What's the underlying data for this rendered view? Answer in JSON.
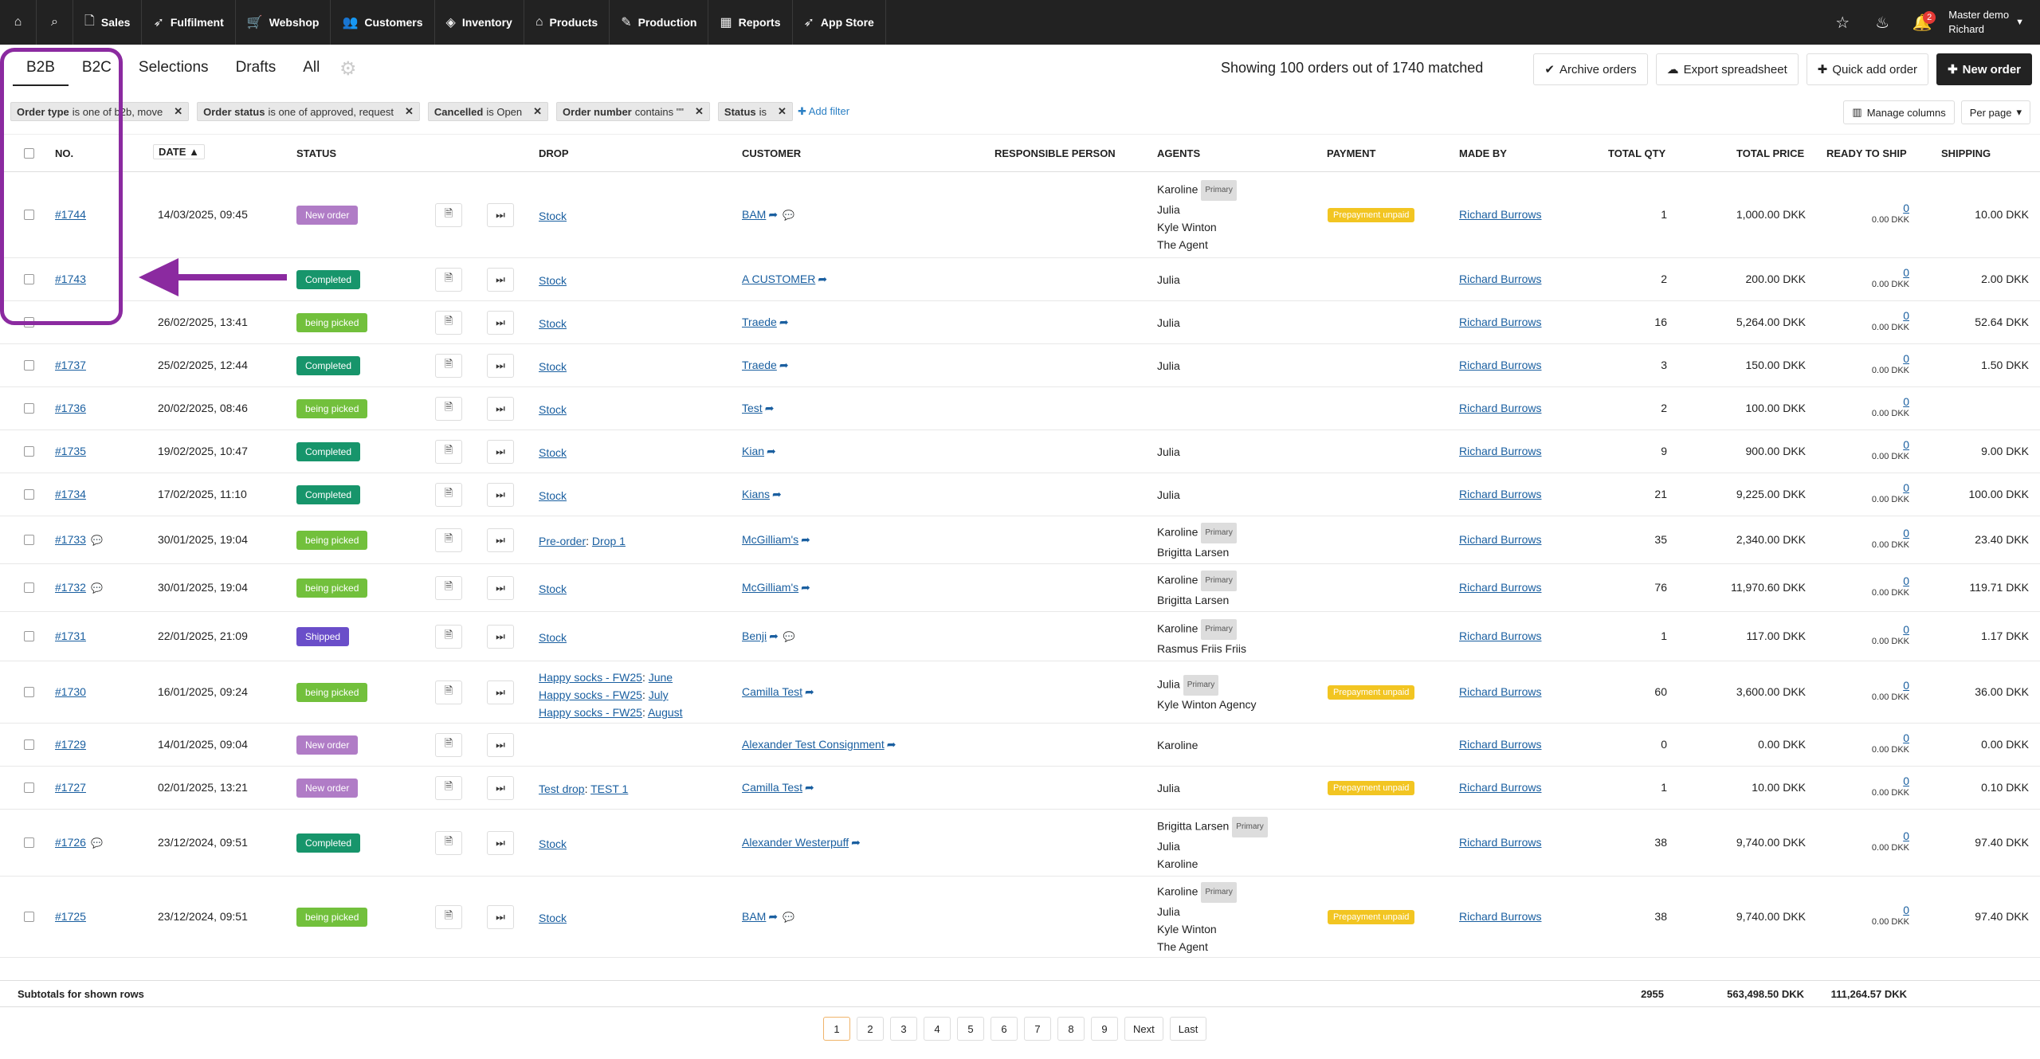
{
  "nav": {
    "items": [
      {
        "label": "Sales",
        "icon": "document-icon"
      },
      {
        "label": "Fulfilment",
        "icon": "rocket-icon"
      },
      {
        "label": "Webshop",
        "icon": "cart-icon"
      },
      {
        "label": "Customers",
        "icon": "users-icon"
      },
      {
        "label": "Inventory",
        "icon": "layers-icon"
      },
      {
        "label": "Products",
        "icon": "tag-icon"
      },
      {
        "label": "Production",
        "icon": "pencil-icon"
      },
      {
        "label": "Reports",
        "icon": "chart-icon"
      },
      {
        "label": "App Store",
        "icon": "rocket-icon"
      }
    ],
    "notifications": "2",
    "user_line1": "Master demo",
    "user_line2": "Richard"
  },
  "tabs": [
    "B2B",
    "B2C",
    "Selections",
    "Drafts",
    "All"
  ],
  "showing": "Showing 100 orders out of 1740 matched",
  "actions": {
    "archive": "Archive orders",
    "export": "Export spreadsheet",
    "quick_add": "Quick add order",
    "new_order": "New order"
  },
  "filters": [
    {
      "field": "Order type",
      "rest": "is one of b2b, move"
    },
    {
      "field": "Order status",
      "rest": "is one of approved, request"
    },
    {
      "field": "Cancelled",
      "rest": "is Open"
    },
    {
      "field": "Order number",
      "rest": "contains \"\""
    },
    {
      "field": "Status",
      "rest": "is"
    }
  ],
  "add_filter": "Add filter",
  "manage_columns": "Manage columns",
  "per_page": "Per page",
  "columns": {
    "no": "NO.",
    "date": "DATE",
    "status": "STATUS",
    "drop": "DROP",
    "customer": "CUSTOMER",
    "responsible": "RESPONSIBLE PERSON",
    "agents": "AGENTS",
    "payment": "PAYMENT",
    "made_by": "MADE BY",
    "total_qty": "TOTAL QTY",
    "total_price": "TOTAL PRICE",
    "ready": "READY TO SHIP",
    "shipping": "SHIPPING"
  },
  "rows": [
    {
      "no": "#1744",
      "date": "14/03/2025, 09:45",
      "status": "New order",
      "drop": "Stock",
      "customer": "BAM",
      "agents": "Karoline|Julia|Kyle Winton|The Agent",
      "payment": "Prepayment unpaid",
      "made_by": "Richard Burrows",
      "qty": "1",
      "price": "1,000.00 DKK",
      "ready": "0",
      "ready_sub": "0.00 DKK",
      "shipping": "10.00 DKK"
    },
    {
      "no": "#1743",
      "date": "",
      "status": "Completed",
      "drop": "Stock",
      "customer": "A CUSTOMER",
      "agents": "Julia",
      "payment": "",
      "made_by": "Richard Burrows",
      "qty": "2",
      "price": "200.00 DKK",
      "ready": "0",
      "ready_sub": "0.00 DKK",
      "shipping": "2.00 DKK"
    },
    {
      "no": "",
      "date": "26/02/2025, 13:41",
      "status": "being picked",
      "drop": "Stock",
      "customer": "Traede",
      "agents": "Julia",
      "payment": "",
      "made_by": "Richard Burrows",
      "qty": "16",
      "price": "5,264.00 DKK",
      "ready": "0",
      "ready_sub": "0.00 DKK",
      "shipping": "52.64 DKK"
    },
    {
      "no": "#1737",
      "date": "25/02/2025, 12:44",
      "status": "Completed",
      "drop": "Stock",
      "customer": "Traede",
      "agents": "Julia",
      "payment": "",
      "made_by": "Richard Burrows",
      "qty": "3",
      "price": "150.00 DKK",
      "ready": "0",
      "ready_sub": "0.00 DKK",
      "shipping": "1.50 DKK"
    },
    {
      "no": "#1736",
      "date": "20/02/2025, 08:46",
      "status": "being picked",
      "drop": "Stock",
      "customer": "Test",
      "agents": "",
      "payment": "",
      "made_by": "Richard Burrows",
      "qty": "2",
      "price": "100.00 DKK",
      "ready": "0",
      "ready_sub": "0.00 DKK",
      "shipping": ""
    },
    {
      "no": "#1735",
      "date": "19/02/2025, 10:47",
      "status": "Completed",
      "drop": "Stock",
      "customer": "Kian",
      "agents": "Julia",
      "payment": "",
      "made_by": "Richard Burrows",
      "qty": "9",
      "price": "900.00 DKK",
      "ready": "0",
      "ready_sub": "0.00 DKK",
      "shipping": "9.00 DKK"
    },
    {
      "no": "#1734",
      "date": "17/02/2025, 11:10",
      "status": "Completed",
      "drop": "Stock",
      "customer": "Kians",
      "agents": "Julia",
      "payment": "",
      "made_by": "Richard Burrows",
      "qty": "21",
      "price": "9,225.00 DKK",
      "ready": "0",
      "ready_sub": "0.00 DKK",
      "shipping": "100.00 DKK"
    },
    {
      "no": "#1733",
      "date": "30/01/2025, 19:04",
      "status": "being picked",
      "drop": "Pre-order|Drop 1",
      "customer": "McGilliam's",
      "agents": "Karoline|Brigitta Larsen",
      "payment": "",
      "made_by": "Richard Burrows",
      "qty": "35",
      "price": "2,340.00 DKK",
      "ready": "0",
      "ready_sub": "0.00 DKK",
      "shipping": "23.40 DKK"
    },
    {
      "no": "#1732",
      "date": "30/01/2025, 19:04",
      "status": "being picked",
      "drop": "Stock",
      "customer": "McGilliam's",
      "agents": "Karoline|Brigitta Larsen",
      "payment": "",
      "made_by": "Richard Burrows",
      "qty": "76",
      "price": "11,970.60 DKK",
      "ready": "0",
      "ready_sub": "0.00 DKK",
      "shipping": "119.71 DKK"
    },
    {
      "no": "#1731",
      "date": "22/01/2025, 21:09",
      "status": "Shipped",
      "drop": "Stock",
      "customer": "Benji",
      "agents": "Karoline|Rasmus Friis Friis",
      "payment": "",
      "made_by": "Richard Burrows",
      "qty": "1",
      "price": "117.00 DKK",
      "ready": "0",
      "ready_sub": "0.00 DKK",
      "shipping": "1.17 DKK"
    },
    {
      "no": "#1730",
      "date": "16/01/2025, 09:24",
      "status": "being picked",
      "drop": "Happy socks - FW25|June|Happy socks - FW25|July|Happy socks - FW25|August",
      "customer": "Camilla Test",
      "agents": "Julia|Kyle Winton Agency",
      "payment": "Prepayment unpaid",
      "made_by": "Richard Burrows",
      "qty": "60",
      "price": "3,600.00 DKK",
      "ready": "0",
      "ready_sub": "0.00 DKK",
      "shipping": "36.00 DKK"
    },
    {
      "no": "#1729",
      "date": "14/01/2025, 09:04",
      "status": "New order",
      "drop": "",
      "customer": "Alexander Test Consignment",
      "agents": "Karoline",
      "payment": "",
      "made_by": "Richard Burrows",
      "qty": "0",
      "price": "0.00 DKK",
      "ready": "0",
      "ready_sub": "0.00 DKK",
      "shipping": "0.00 DKK"
    },
    {
      "no": "#1727",
      "date": "02/01/2025, 13:21",
      "status": "New order",
      "drop": "Test drop|TEST 1",
      "customer": "Camilla Test",
      "agents": "Julia",
      "payment": "Prepayment unpaid",
      "made_by": "Richard Burrows",
      "qty": "1",
      "price": "10.00 DKK",
      "ready": "0",
      "ready_sub": "0.00 DKK",
      "shipping": "0.10 DKK"
    },
    {
      "no": "#1726",
      "date": "23/12/2024, 09:51",
      "status": "Completed",
      "drop": "Stock",
      "customer": "Alexander Westerpuff",
      "agents": "Brigitta Larsen|Julia|Karoline",
      "payment": "",
      "made_by": "Richard Burrows",
      "qty": "38",
      "price": "9,740.00 DKK",
      "ready": "0",
      "ready_sub": "0.00 DKK",
      "shipping": "97.40 DKK"
    },
    {
      "no": "#1725",
      "date": "23/12/2024, 09:51",
      "status": "being picked",
      "drop": "Stock",
      "customer": "BAM",
      "agents": "Karoline|Julia|Kyle Winton|The Agent",
      "payment": "Prepayment unpaid",
      "made_by": "Richard Burrows",
      "qty": "38",
      "price": "9,740.00 DKK",
      "ready": "0",
      "ready_sub": "0.00 DKK",
      "shipping": "97.40 DKK"
    }
  ],
  "primary_label": "Primary",
  "subtotals": {
    "label": "Subtotals for shown rows",
    "qty": "2955",
    "price": "563,498.50 DKK",
    "ready": "111,264.57 DKK"
  },
  "pager": [
    "1",
    "2",
    "3",
    "4",
    "5",
    "6",
    "7",
    "8",
    "9",
    "Next",
    "Last"
  ],
  "colors": {
    "nav_bg": "#222222",
    "annotation": "#8b2aa0",
    "completed": "#17956b",
    "picked": "#72c03c",
    "new": "#b07cc6",
    "shipped": "#6a4ec9",
    "prepay": "#f2c522"
  }
}
